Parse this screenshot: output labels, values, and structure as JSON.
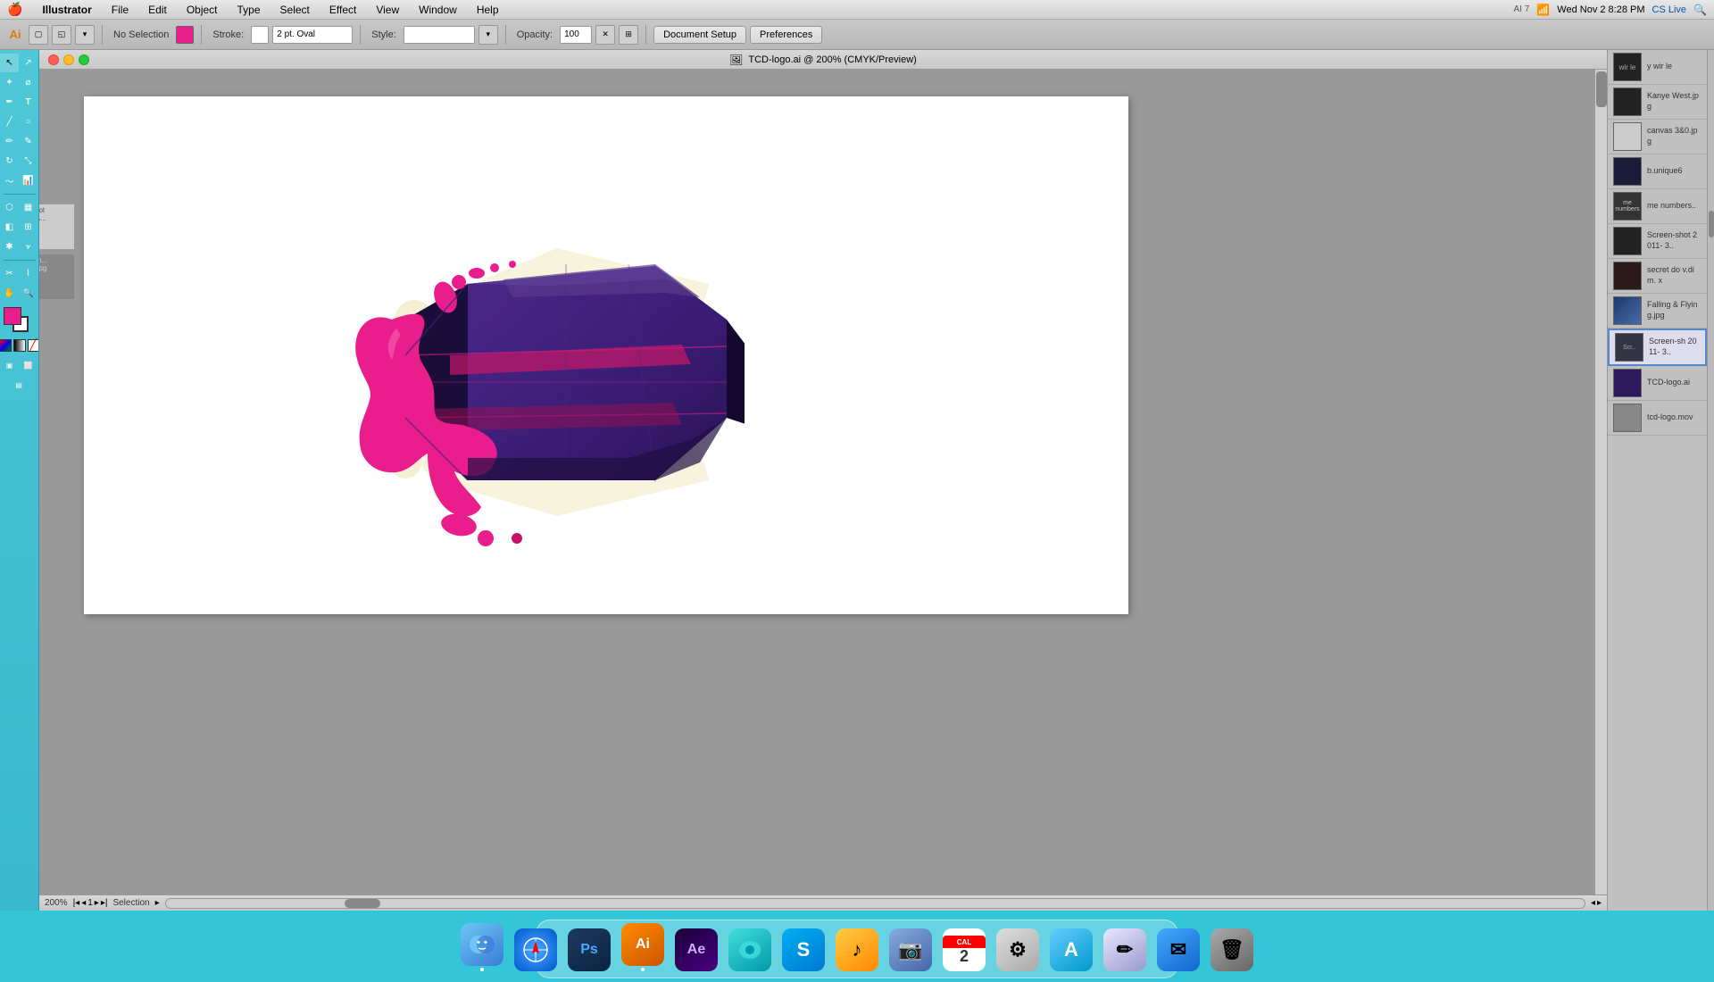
{
  "menubar": {
    "apple": "🍎",
    "items": [
      "Illustrator",
      "File",
      "Edit",
      "Object",
      "Type",
      "Select",
      "Effect",
      "View",
      "Window",
      "Help"
    ],
    "right": {
      "ai_version": "AI 7",
      "wifi": "WiFi",
      "time": "Wed Nov 2  8:28 PM",
      "user": "CS Live"
    }
  },
  "toolbar": {
    "tool_label": "No Selection",
    "fill_color": "#e91e8c",
    "stroke_label": "Stroke:",
    "stroke_value": "",
    "stroke_size": "2 pt. Oval",
    "style_label": "Style:",
    "opacity_label": "Opacity:",
    "opacity_value": "100",
    "document_setup_btn": "Document Setup",
    "preferences_btn": "Preferences"
  },
  "canvas": {
    "title": "TCD-logo.ai @ 200% (CMYK/Preview)",
    "zoom": "200%",
    "mode_label": "Selection"
  },
  "right_panel": {
    "items": [
      {
        "label": "y wir le",
        "type": "dark"
      },
      {
        "label": "Kanye West.jpg",
        "type": "dark"
      },
      {
        "label": "canvas 3&0.jpg",
        "type": "light"
      },
      {
        "label": "b.unique6",
        "type": "dark"
      },
      {
        "label": "me numbers..",
        "type": "dark"
      },
      {
        "label": "Screen-shot 2011-  3..",
        "type": "dark"
      },
      {
        "label": "secret do v.dim. x",
        "type": "dark"
      },
      {
        "label": "Falling & Flying.jpg",
        "type": "blue"
      },
      {
        "label": "Screen-sh 2011-  3..",
        "type": "dark"
      },
      {
        "label": "TCD-logo.ai",
        "type": "purple"
      },
      {
        "label": "tcd-logo.mov",
        "type": "light"
      }
    ]
  },
  "dock": {
    "items": [
      {
        "name": "Finder",
        "icon_type": "finder-icon",
        "symbol": "🔍",
        "has_dot": false
      },
      {
        "name": "Safari",
        "icon_type": "safari-icon",
        "symbol": "⬤",
        "has_dot": false
      },
      {
        "name": "Photoshop",
        "icon_type": "ps-icon",
        "symbol": "Ps",
        "has_dot": false
      },
      {
        "name": "Illustrator",
        "icon_type": "ai-icon",
        "symbol": "Ai",
        "has_dot": true
      },
      {
        "name": "After Effects",
        "icon_type": "ae-icon",
        "symbol": "Ae",
        "has_dot": false
      },
      {
        "name": "OS X",
        "icon_type": "osx-icon",
        "symbol": "⬤",
        "has_dot": false
      },
      {
        "name": "Skype",
        "icon_type": "skype-icon",
        "symbol": "S",
        "has_dot": false
      },
      {
        "name": "iTunes",
        "icon_type": "itunes-icon",
        "symbol": "♪",
        "has_dot": false
      },
      {
        "name": "iPhoto",
        "icon_type": "iphoto-icon",
        "symbol": "📷",
        "has_dot": false
      },
      {
        "name": "Calendar",
        "icon_type": "cal-icon",
        "symbol": "2",
        "has_dot": false
      },
      {
        "name": "System Prefs",
        "icon_type": "sysref-icon",
        "symbol": "⚙",
        "has_dot": false
      },
      {
        "name": "Mac App Store",
        "icon_type": "macstore-icon",
        "symbol": "A",
        "has_dot": false
      },
      {
        "name": "Pencil",
        "icon_type": "pencil-icon",
        "symbol": "/",
        "has_dot": false
      },
      {
        "name": "Mail",
        "icon_type": "mail-icon",
        "symbol": "✉",
        "has_dot": false
      },
      {
        "name": "Trash",
        "icon_type": "trash-icon",
        "symbol": "🗑",
        "has_dot": false
      }
    ]
  }
}
